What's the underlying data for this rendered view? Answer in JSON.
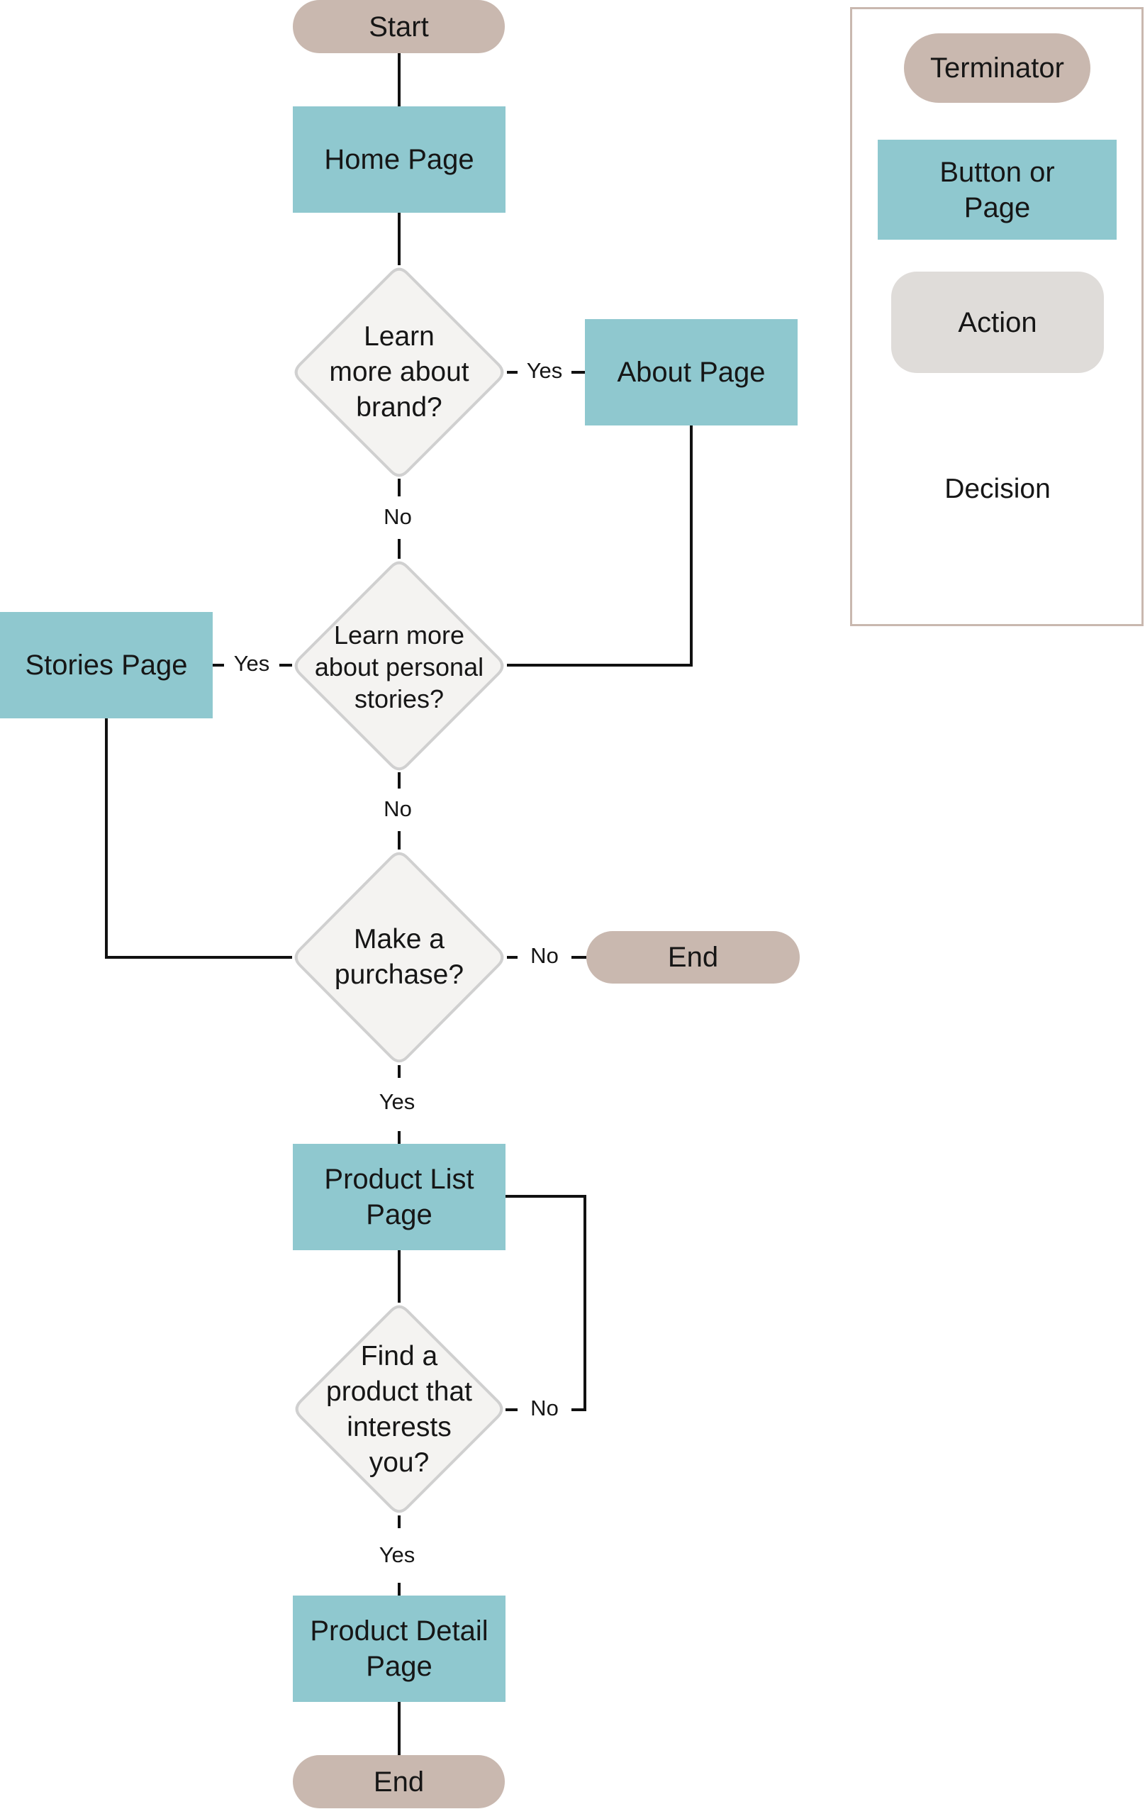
{
  "colors": {
    "terminator": "#C9B8AF",
    "page": "#8FC8CF",
    "action": "#DFDCD9",
    "decision_fill": "#F4F3F1",
    "decision_stroke": "#D0D0D0",
    "connector": "#111111",
    "legend_border": "#C9B8AF"
  },
  "nodes": {
    "start": "Start",
    "home": "Home Page",
    "d_brand": [
      "Learn",
      "more about",
      "brand?"
    ],
    "about": "About Page",
    "d_stories": [
      "Learn more",
      "about personal",
      "stories?"
    ],
    "stories": "Stories Page",
    "d_purchase": [
      "Make a",
      "purchase?"
    ],
    "end_1": "End",
    "product_list": [
      "Product List",
      "Page"
    ],
    "d_find": [
      "Find a",
      "product that",
      "interests",
      "you?"
    ],
    "product_detail": [
      "Product Detail",
      "Page"
    ],
    "end_2": "End"
  },
  "edge_labels": {
    "brand_yes": "Yes",
    "brand_no": "No",
    "stories_yes": "Yes",
    "stories_no": "No",
    "purchase_no": "No",
    "purchase_yes": "Yes",
    "find_no": "No",
    "find_yes": "Yes"
  },
  "legend": {
    "terminator": "Terminator",
    "button_or_page": [
      "Button or",
      "Page"
    ],
    "action": "Action",
    "decision": "Decision"
  }
}
